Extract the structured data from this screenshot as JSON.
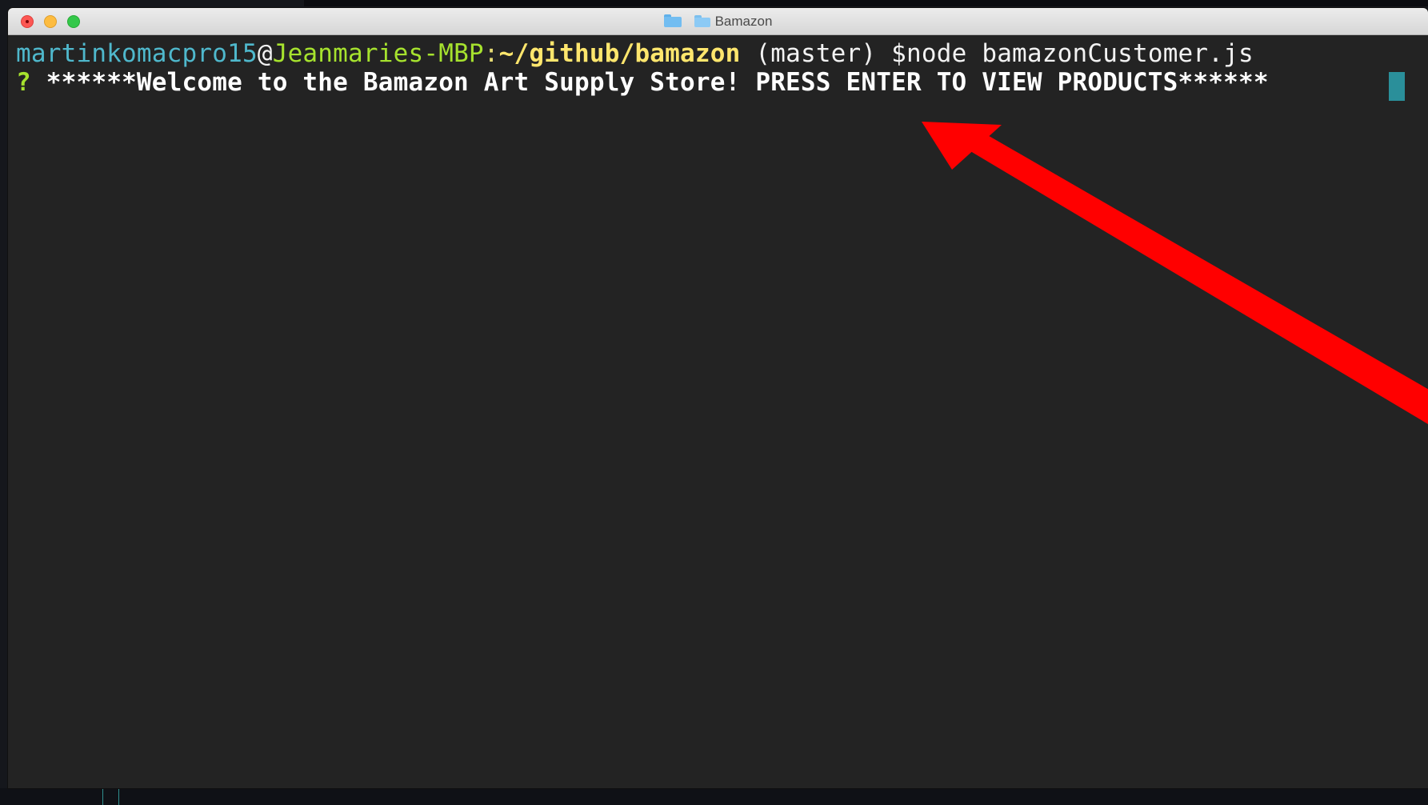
{
  "window": {
    "title": "Bamazon"
  },
  "terminal": {
    "prompt_user": "martinkomacpro15",
    "prompt_at": "@",
    "prompt_host": "Jeanmaries-MBP",
    "prompt_colon": ":",
    "prompt_path": "~/github/bamazon",
    "prompt_branch": " (master) ",
    "prompt_symbol": "$",
    "command": "node bamazonCustomer.js",
    "question_mark": "?",
    "welcome_message": " ******Welcome to the Bamazon Art Supply Store! PRESS ENTER TO VIEW PRODUCTS****** "
  },
  "icons": {
    "title_folder": "folder-icon",
    "title_folder_small": "folder-icon",
    "cursor": "cursor-block"
  },
  "colors": {
    "terminal_bg": "#232323",
    "user": "#4fb8cc",
    "host": "#a6e22e",
    "path": "#ffe66d",
    "cursor": "#2a8f9a",
    "annotation_arrow": "#ff0000"
  }
}
